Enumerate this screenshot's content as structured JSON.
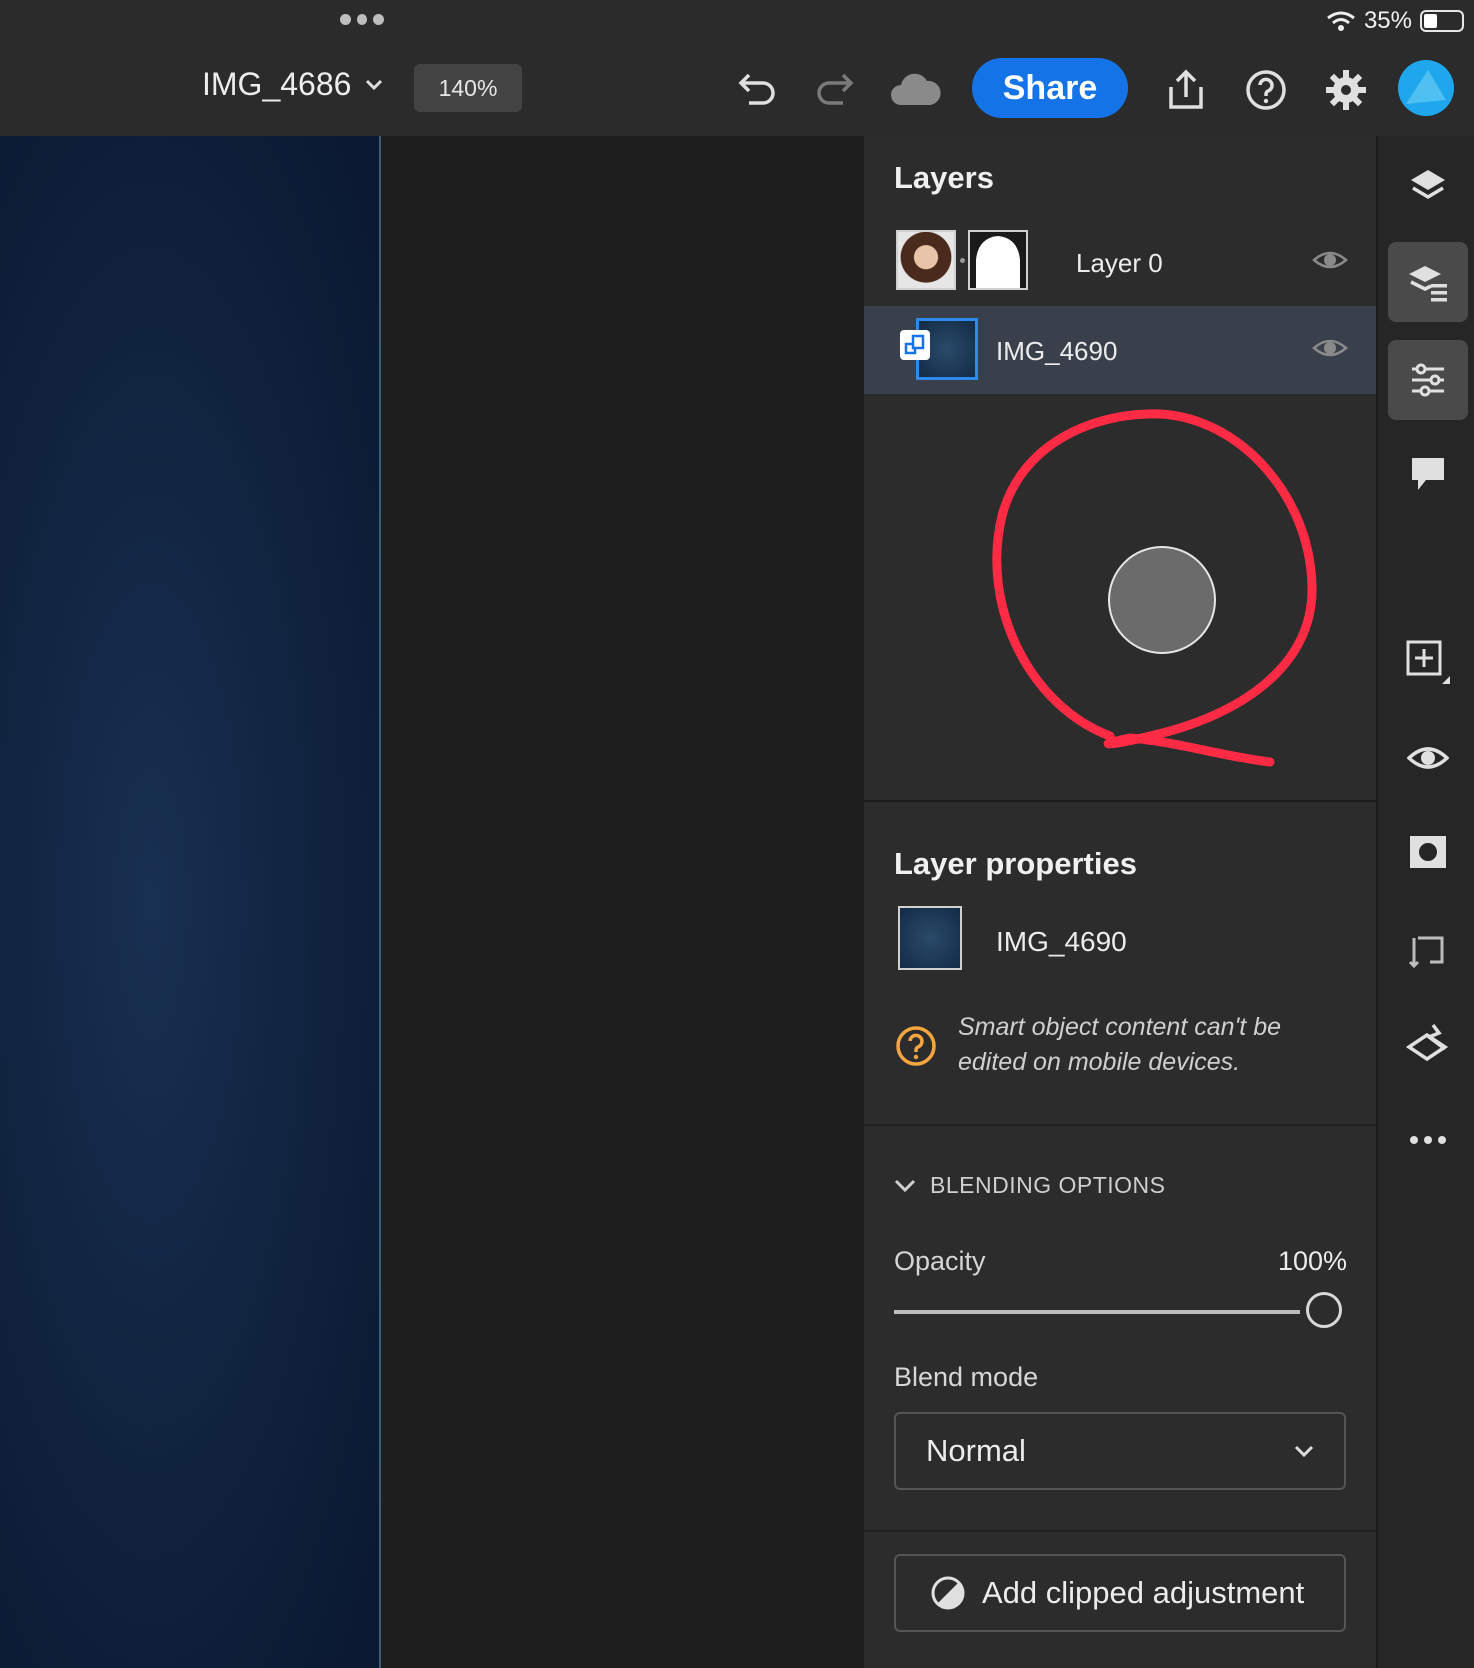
{
  "status_bar": {
    "battery": "35%",
    "battery_level": 0.35
  },
  "header": {
    "document_title": "IMG_4686",
    "zoom": "140%",
    "share_label": "Share",
    "icons": [
      "more-dots-icon",
      "chevron-down-icon",
      "undo-icon",
      "redo-icon",
      "cloud-icon",
      "export-icon",
      "help-icon",
      "gear-icon",
      "avatar"
    ]
  },
  "layers": {
    "title": "Layers",
    "items": [
      {
        "name": "Layer 0",
        "selected": false,
        "has_mask": true,
        "visible": true
      },
      {
        "name": "IMG_4690",
        "selected": true,
        "smart_object": true,
        "visible": true
      }
    ]
  },
  "annotation": {
    "color": "#ff2a44",
    "shape": "hand-drawn circle around gray dot"
  },
  "layer_properties": {
    "title": "Layer properties",
    "layer_name": "IMG_4690",
    "info_line1": "Smart object content can't be",
    "info_line2": "edited on mobile devices.",
    "blending": {
      "header": "BLENDING OPTIONS",
      "opacity_label": "Opacity",
      "opacity_value": "100%",
      "opacity_level": 1.0,
      "blend_label": "Blend mode",
      "blend_value": "Normal"
    },
    "clip_button": "Add clipped adjustment"
  },
  "rail": {
    "icons": [
      "layers-icon",
      "layer-properties-icon",
      "adjustments-icon",
      "comments-icon",
      "add-layer-icon",
      "visibility-icon",
      "mask-icon",
      "transform-icon",
      "eraser-icon",
      "more-icon"
    ],
    "active": [
      "layer-properties-icon",
      "adjustments-icon"
    ]
  },
  "colors": {
    "accent": "#1473e6",
    "warning": "#f6a640",
    "panel": "#2c2c2c",
    "selected_row": "#39404c"
  }
}
